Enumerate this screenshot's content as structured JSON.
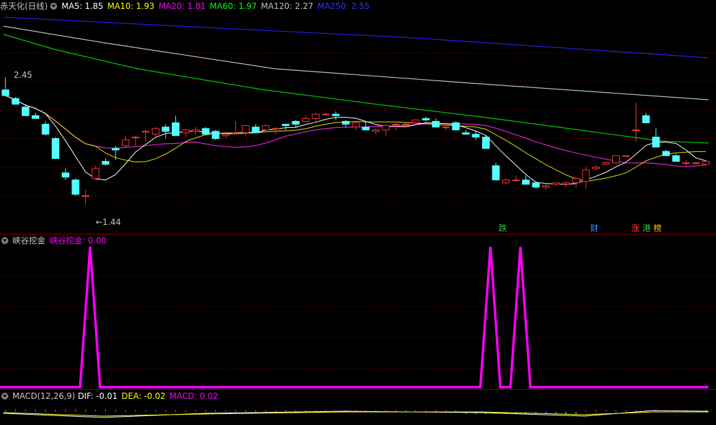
{
  "main": {
    "stock_name": "赤天化(日线)",
    "ma": [
      {
        "label": "MA5: 1.85",
        "color": "#ffffff"
      },
      {
        "label": "MA10: 1.93",
        "color": "#ffff00"
      },
      {
        "label": "MA20: 1.81",
        "color": "#ff00ff"
      },
      {
        "label": "MA60: 1.97",
        "color": "#00ff00"
      },
      {
        "label": "MA120: 2.27",
        "color": "#c0c0c0"
      },
      {
        "label": "MA250: 2.55",
        "color": "#3333ff"
      }
    ],
    "high_mark": "2.45",
    "low_mark": "←1.44",
    "badges": [
      {
        "text": "跌",
        "color": "#33cc33"
      },
      {
        "text": "财",
        "color": "#3399ff"
      },
      {
        "text": "涨",
        "color": "#ff4444"
      },
      {
        "text": "港",
        "color": "#33cc33"
      },
      {
        "text": "榜",
        "color": "#ffcc00"
      }
    ]
  },
  "indicator": {
    "name": "峡谷挖金",
    "value_label": "峡谷挖金: 0.00",
    "color": "#ff00ff"
  },
  "macd": {
    "name": "MACD(12,26,9)",
    "dif": "DIF: -0.01",
    "dea": "DEA: -0.02",
    "macd": "MACD: 0.02"
  },
  "chart_data": {
    "type": "candlestick",
    "y_range_visible": [
      1.44,
      2.45
    ],
    "candles": [
      {
        "o": 2.36,
        "h": 2.45,
        "l": 2.32,
        "c": 2.32
      },
      {
        "o": 2.3,
        "h": 2.31,
        "l": 2.26,
        "c": 2.26
      },
      {
        "o": 2.24,
        "h": 2.26,
        "l": 2.18,
        "c": 2.18
      },
      {
        "o": 2.18,
        "h": 2.2,
        "l": 2.16,
        "c": 2.16
      },
      {
        "o": 2.12,
        "h": 2.14,
        "l": 2.04,
        "c": 2.05
      },
      {
        "o": 2.02,
        "h": 2.03,
        "l": 1.88,
        "c": 1.88
      },
      {
        "o": 1.78,
        "h": 1.81,
        "l": 1.73,
        "c": 1.75
      },
      {
        "o": 1.73,
        "h": 1.74,
        "l": 1.62,
        "c": 1.63
      },
      {
        "o": 1.62,
        "h": 1.66,
        "l": 1.56,
        "c": 1.62
      },
      {
        "o": 1.74,
        "h": 1.83,
        "l": 1.73,
        "c": 1.81
      },
      {
        "o": 1.86,
        "h": 1.88,
        "l": 1.83,
        "c": 1.84
      },
      {
        "o": 1.95,
        "h": 1.97,
        "l": 1.87,
        "c": 1.94
      },
      {
        "o": 1.97,
        "h": 2.04,
        "l": 1.96,
        "c": 2.01
      },
      {
        "o": 2.03,
        "h": 2.04,
        "l": 1.96,
        "c": 2.03
      },
      {
        "o": 2.07,
        "h": 2.08,
        "l": 2.0,
        "c": 2.07
      },
      {
        "o": 2.05,
        "h": 2.1,
        "l": 2.03,
        "c": 2.09
      },
      {
        "o": 2.1,
        "h": 2.12,
        "l": 2.02,
        "c": 2.07
      },
      {
        "o": 2.13,
        "h": 2.18,
        "l": 2.04,
        "c": 2.04
      },
      {
        "o": 2.06,
        "h": 2.09,
        "l": 2.03,
        "c": 2.08
      },
      {
        "o": 2.07,
        "h": 2.1,
        "l": 2.05,
        "c": 2.08
      },
      {
        "o": 2.09,
        "h": 2.1,
        "l": 2.05,
        "c": 2.05
      },
      {
        "o": 2.07,
        "h": 2.08,
        "l": 2.01,
        "c": 2.02
      },
      {
        "o": 2.04,
        "h": 2.07,
        "l": 2.02,
        "c": 2.05
      },
      {
        "o": 2.06,
        "h": 2.14,
        "l": 2.05,
        "c": 2.06
      },
      {
        "o": 2.06,
        "h": 2.11,
        "l": 2.04,
        "c": 2.11
      },
      {
        "o": 2.1,
        "h": 2.12,
        "l": 2.06,
        "c": 2.06
      },
      {
        "o": 2.08,
        "h": 2.12,
        "l": 2.08,
        "c": 2.11
      },
      {
        "o": 2.09,
        "h": 2.1,
        "l": 2.05,
        "c": 2.09
      },
      {
        "o": 2.12,
        "h": 2.12,
        "l": 2.08,
        "c": 2.11
      },
      {
        "o": 2.14,
        "h": 2.15,
        "l": 2.1,
        "c": 2.12
      },
      {
        "o": 2.14,
        "h": 2.18,
        "l": 2.13,
        "c": 2.16
      },
      {
        "o": 2.16,
        "h": 2.2,
        "l": 2.14,
        "c": 2.19
      },
      {
        "o": 2.19,
        "h": 2.2,
        "l": 2.18,
        "c": 2.19
      },
      {
        "o": 2.19,
        "h": 2.21,
        "l": 2.15,
        "c": 2.18
      },
      {
        "o": 2.14,
        "h": 2.15,
        "l": 2.1,
        "c": 2.12
      },
      {
        "o": 2.1,
        "h": 2.13,
        "l": 2.08,
        "c": 2.13
      },
      {
        "o": 2.1,
        "h": 2.14,
        "l": 2.08,
        "c": 2.08
      },
      {
        "o": 2.07,
        "h": 2.09,
        "l": 2.05,
        "c": 2.08
      },
      {
        "o": 2.08,
        "h": 2.12,
        "l": 2.04,
        "c": 2.11
      },
      {
        "o": 2.12,
        "h": 2.13,
        "l": 2.08,
        "c": 2.12
      },
      {
        "o": 2.12,
        "h": 2.13,
        "l": 2.1,
        "c": 2.12
      },
      {
        "o": 2.13,
        "h": 2.15,
        "l": 2.13,
        "c": 2.15
      },
      {
        "o": 2.16,
        "h": 2.17,
        "l": 2.14,
        "c": 2.15
      },
      {
        "o": 2.14,
        "h": 2.16,
        "l": 2.1,
        "c": 2.1
      },
      {
        "o": 2.1,
        "h": 2.13,
        "l": 2.08,
        "c": 2.1
      },
      {
        "o": 2.13,
        "h": 2.14,
        "l": 2.08,
        "c": 2.08
      },
      {
        "o": 2.06,
        "h": 2.08,
        "l": 2.05,
        "c": 2.05
      },
      {
        "o": 2.05,
        "h": 2.07,
        "l": 2.01,
        "c": 2.03
      },
      {
        "o": 2.03,
        "h": 2.04,
        "l": 1.95,
        "c": 1.95
      },
      {
        "o": 1.83,
        "h": 1.85,
        "l": 1.73,
        "c": 1.73
      },
      {
        "o": 1.71,
        "h": 1.74,
        "l": 1.7,
        "c": 1.73
      },
      {
        "o": 1.73,
        "h": 1.76,
        "l": 1.72,
        "c": 1.73
      },
      {
        "o": 1.73,
        "h": 1.76,
        "l": 1.7,
        "c": 1.7
      },
      {
        "o": 1.71,
        "h": 1.72,
        "l": 1.67,
        "c": 1.68
      },
      {
        "o": 1.68,
        "h": 1.7,
        "l": 1.66,
        "c": 1.69
      },
      {
        "o": 1.7,
        "h": 1.71,
        "l": 1.69,
        "c": 1.71
      },
      {
        "o": 1.7,
        "h": 1.72,
        "l": 1.68,
        "c": 1.71
      },
      {
        "o": 1.71,
        "h": 1.75,
        "l": 1.68,
        "c": 1.74
      },
      {
        "o": 1.72,
        "h": 1.82,
        "l": 1.67,
        "c": 1.8
      },
      {
        "o": 1.81,
        "h": 1.83,
        "l": 1.8,
        "c": 1.82
      },
      {
        "o": 1.84,
        "h": 1.86,
        "l": 1.84,
        "c": 1.85
      },
      {
        "o": 1.85,
        "h": 1.9,
        "l": 1.84,
        "c": 1.9
      },
      {
        "o": 1.9,
        "h": 1.9,
        "l": 1.89,
        "c": 1.9
      },
      {
        "o": 2.08,
        "h": 2.27,
        "l": 2.0,
        "c": 2.08
      },
      {
        "o": 2.18,
        "h": 2.2,
        "l": 2.13,
        "c": 2.13
      },
      {
        "o": 2.03,
        "h": 2.09,
        "l": 1.96,
        "c": 1.96
      },
      {
        "o": 1.93,
        "h": 1.94,
        "l": 1.9,
        "c": 1.9
      },
      {
        "o": 1.9,
        "h": 1.91,
        "l": 1.86,
        "c": 1.86
      },
      {
        "o": 1.85,
        "h": 1.87,
        "l": 1.83,
        "c": 1.85
      },
      {
        "o": 1.85,
        "h": 1.86,
        "l": 1.84,
        "c": 1.85
      },
      {
        "o": 1.84,
        "h": 1.87,
        "l": 1.83,
        "c": 1.86
      }
    ],
    "indicator_values": [
      0,
      0,
      0,
      0,
      0,
      0,
      0,
      0,
      0,
      1,
      0,
      0,
      0,
      0,
      0,
      0,
      0,
      0,
      0,
      0,
      0,
      0,
      0,
      0,
      0,
      0,
      0,
      0,
      0,
      0,
      0,
      0,
      0,
      0,
      0,
      0,
      0,
      0,
      0,
      0,
      0,
      0,
      0,
      0,
      0,
      0,
      0,
      0,
      0,
      1,
      0,
      0,
      1,
      0,
      0,
      0,
      0,
      0,
      0,
      0,
      0,
      0,
      0,
      0,
      0,
      0,
      0,
      0,
      0,
      0,
      0
    ]
  }
}
